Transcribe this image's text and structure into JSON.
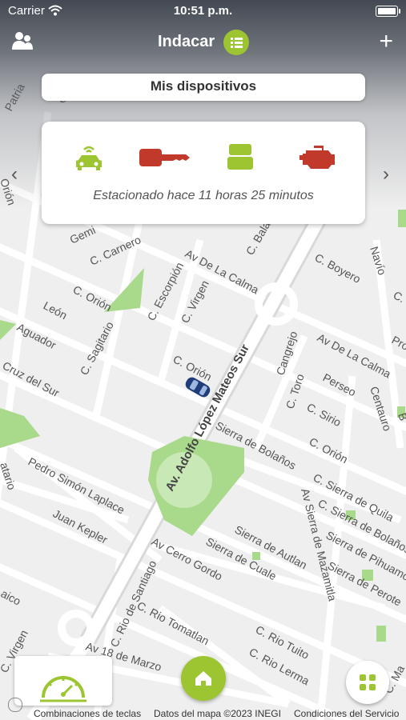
{
  "status_bar": {
    "carrier": "Carrier",
    "time": "10:51 p.m."
  },
  "nav": {
    "title": "Indacar"
  },
  "devices_bar": {
    "label": "Mis dispositivos"
  },
  "card": {
    "icons": [
      "car-wifi-icon",
      "key-icon",
      "obd-device-icon",
      "engine-icon"
    ],
    "status_text": "Estacionado hace 11 horas 25 minutos"
  },
  "map": {
    "streets": [
      "C. Carnero",
      "Av De La Calma",
      "C. Balanza",
      "C. Boyero",
      "Navío",
      "C. Orión",
      "C. Escorpión",
      "C. Virgen",
      "León",
      "Aguador",
      "C. Sagitario",
      "Cruz del Sur",
      "C. Orión",
      "Cangrejo",
      "Av De La Calma",
      "Perseo",
      "C. Toro",
      "C. Sirio",
      "Centauro",
      "Av. Adolfo López Mateos Sur",
      "Sierra de Bolaños",
      "C. Orión",
      "Pedro Simón Laplace",
      "Juan Kepler",
      "C. Sierra de Quila",
      "C. Sierra de Bolaños",
      "Av Sierra de Mazamitla",
      "Sierra de Pihuamo",
      "Av Cerro Gordo",
      "Sierra de Cuale",
      "Sierra de Autlan",
      "Sierra de Perote",
      "C. Rio de Santiago",
      "C. Rio Tomatlan",
      "C. Rio Tuito",
      "C. Rio Lerma",
      "Av 18 de Marzo",
      "C. Virgen",
      "Gemi",
      "C. Ma",
      "Patria",
      "Orión",
      "Pro",
      "C. Is",
      "B",
      "atario",
      "aico",
      "C. Ma"
    ],
    "attribution": [
      "Combinaciones de teclas",
      "Datos del mapa ©2023 INEGI",
      "Condiciones del Servicio"
    ]
  },
  "colors": {
    "accent": "#9cc531",
    "alert": "#c0392b",
    "top_bar": "#3a404a"
  }
}
